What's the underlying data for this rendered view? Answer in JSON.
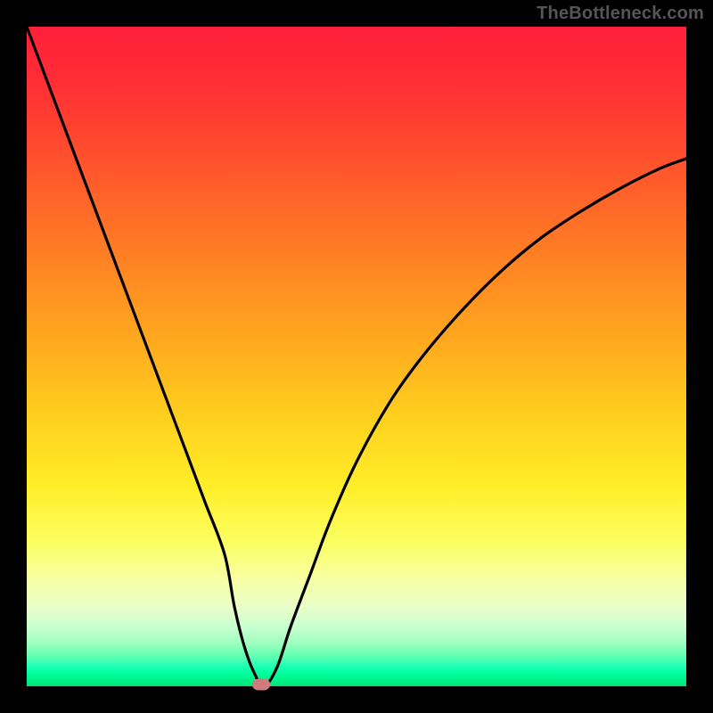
{
  "watermark": "TheBottleneck.com",
  "colors": {
    "frame": "#000000",
    "curve": "#000000",
    "marker": "#cf7a7c"
  },
  "chart_data": {
    "type": "line",
    "title": "",
    "xlabel": "",
    "ylabel": "",
    "xlim": [
      0,
      100
    ],
    "ylim": [
      0,
      100
    ],
    "grid": false,
    "legend": false,
    "series": [
      {
        "name": "curve",
        "x": [
          0,
          3,
          6,
          9,
          12,
          15,
          18,
          21,
          24,
          27,
          30,
          31.5,
          33,
          34.5,
          36,
          38,
          40,
          43,
          46,
          50,
          55,
          60,
          66,
          72,
          78,
          84,
          90,
          96,
          100
        ],
        "y": [
          100,
          92,
          84,
          76,
          68,
          60,
          52,
          44,
          36,
          28,
          20,
          12,
          6,
          2,
          0,
          3,
          9,
          17,
          25,
          34,
          43,
          50,
          57,
          63,
          68,
          72,
          75.5,
          78.5,
          80
        ],
        "note": "V-shaped curve with minimum near x≈35; left branch nearly linear from (0,100) to (35,0); right branch rises concavely toward ~(100,80)."
      }
    ],
    "marker": {
      "x": 35.5,
      "y": 0.3
    },
    "background_gradient": {
      "direction": "vertical",
      "stops": [
        {
          "pos": 0.0,
          "color": "#ff1f3a"
        },
        {
          "pos": 0.5,
          "color": "#ffaa1e"
        },
        {
          "pos": 0.78,
          "color": "#fcff60"
        },
        {
          "pos": 0.92,
          "color": "#9effc0"
        },
        {
          "pos": 1.0,
          "color": "#00e676"
        }
      ]
    }
  }
}
